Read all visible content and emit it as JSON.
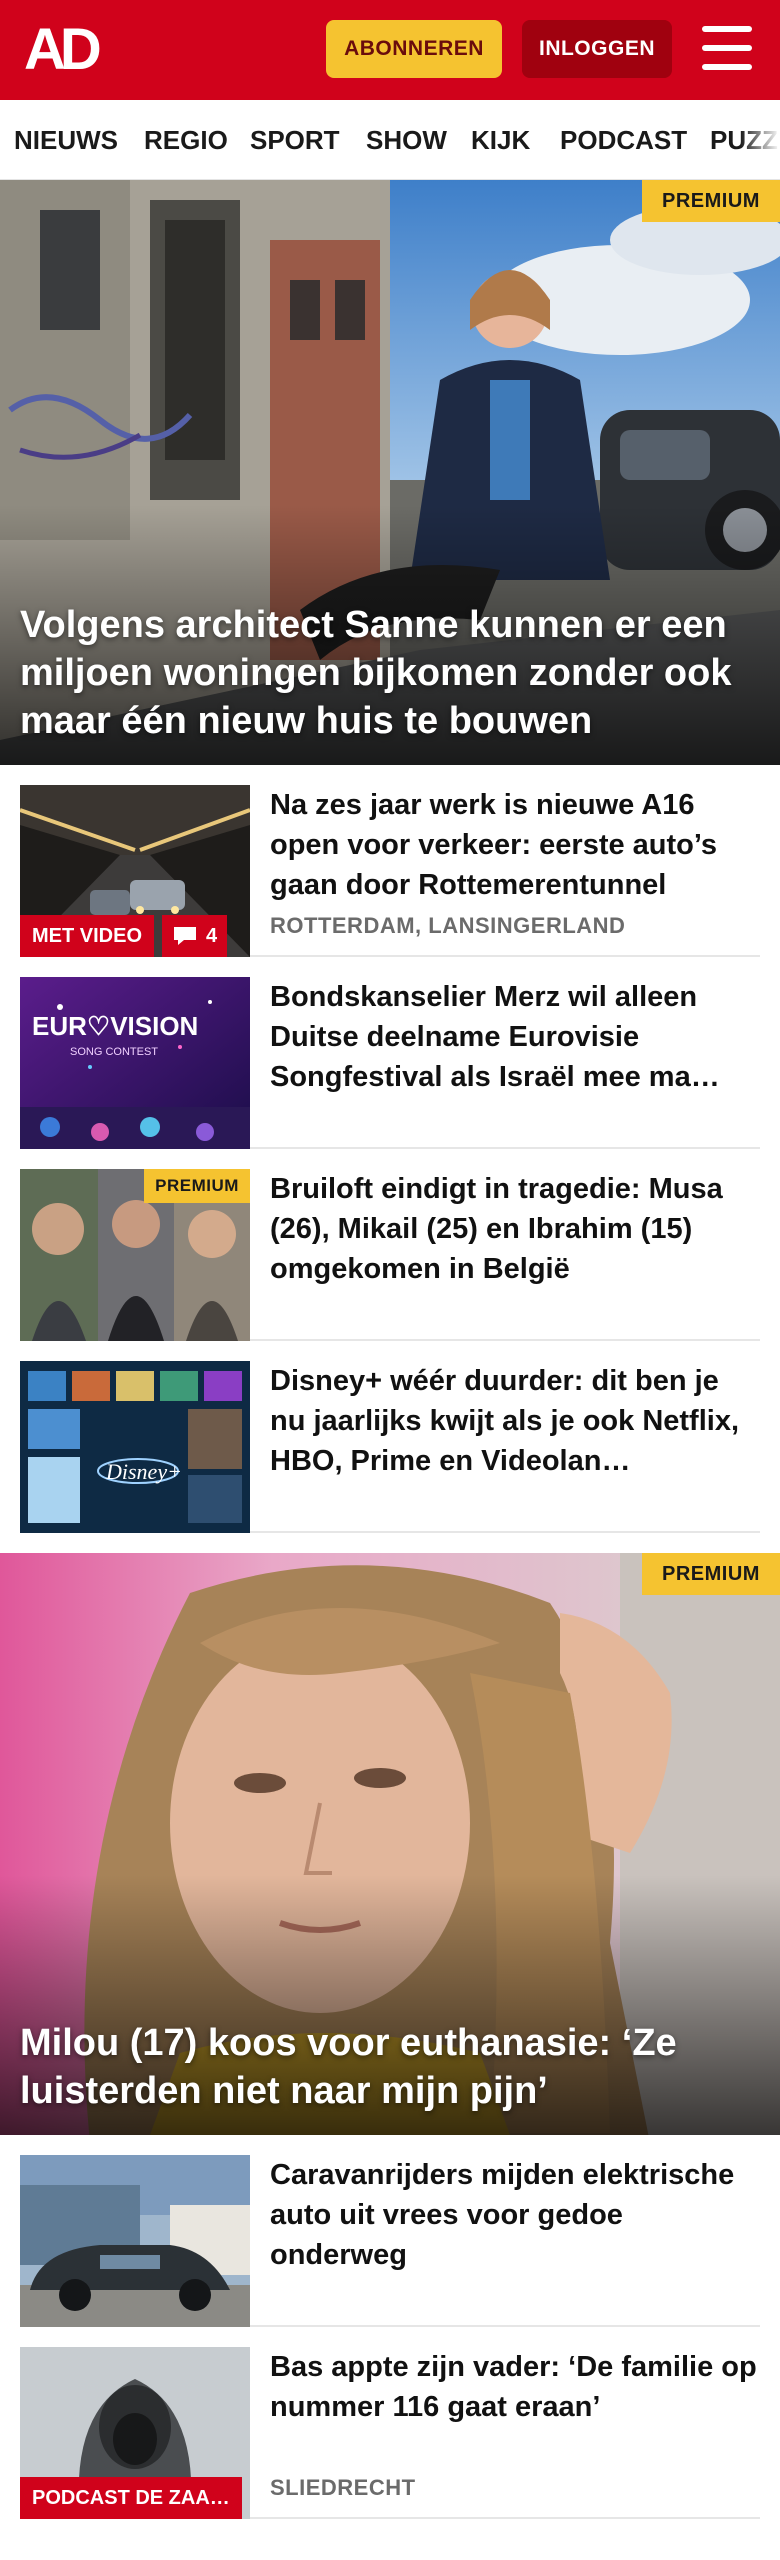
{
  "header": {
    "logo_text": "AD",
    "subscribe_label": "ABONNEREN",
    "login_label": "INLOGGEN",
    "brand_color": "#d0021b"
  },
  "nav": {
    "items": [
      "NIEUWS",
      "REGIO",
      "SPORT",
      "SHOW",
      "KIJK",
      "PODCAST",
      "PUZZ"
    ]
  },
  "hero1": {
    "badge": "PREMIUM",
    "title": "Volgens architect Sanne kunnen er een miljoen woningen bijkomen zonder ook maar één nieuw huis te bouwen"
  },
  "articles": [
    {
      "title": "Na zes jaar werk is nieuwe A16 open voor verkeer: eerste auto’s gaan door Rottemerentunnel",
      "meta": "ROTTERDAM, LANSINGERLAND",
      "video_tag": "MET VIDEO",
      "comments": "4"
    },
    {
      "title": "Bondskanselier Merz wil alleen Duitse deelname Eurovisie Songfestival als Israël mee ma…",
      "thumb_text": "EUROVISION SONG CONTEST"
    },
    {
      "title": "Bruiloft eindigt in tragedie: Musa (26), Mikail (25) en Ibrahim (15) omgekomen in België",
      "badge": "PREMIUM"
    },
    {
      "title": "Disney+ wéér duurder: dit ben je nu jaarlijks kwijt als je ook Netflix, HBO, Prime en Videolan…"
    }
  ],
  "hero2": {
    "badge": "PREMIUM",
    "title": "Milou (17) koos voor euthanasie: ‘Ze luisterden niet naar mijn pijn’"
  },
  "articles2": [
    {
      "title": "Caravanrijders mijden elektri­sche auto uit vrees voor gedoe onderweg"
    },
    {
      "title": "Bas appte zijn vader: ‘De familie op nummer 116 gaat eraan’",
      "meta": "SLIEDRECHT",
      "podcast_tag": "PODCAST DE ZAA…"
    }
  ]
}
